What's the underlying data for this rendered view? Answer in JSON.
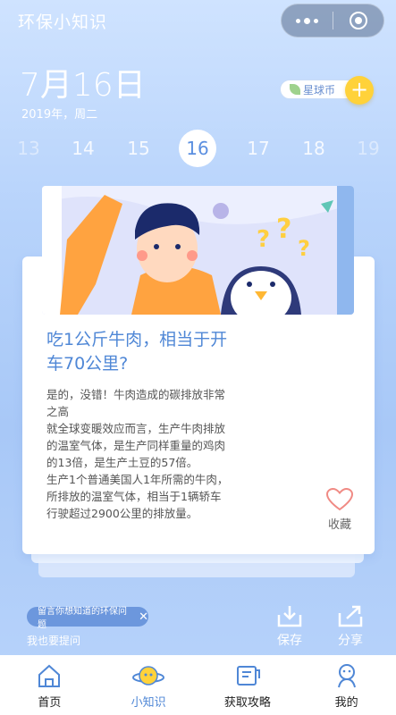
{
  "header": {
    "app_title": "环保小知识"
  },
  "date_header": {
    "big_date": "7月16日",
    "sub_date": "2019年，周二",
    "coin_label": "星球币",
    "plus": "+"
  },
  "date_strip": {
    "days": [
      "13",
      "14",
      "15",
      "16",
      "17",
      "18",
      "19"
    ],
    "selected": "16"
  },
  "card": {
    "title": "吃1公斤牛肉，相当于开车70公里?",
    "body": [
      "是的，没错！牛肉造成的碳排放非常之高",
      "就全球变暖效应而言，生产牛肉排放的温室气体，是生产同样重量的鸡肉的13倍，是生产土豆的57倍。",
      "生产1个普通美国人1年所需的牛肉，所排放的温室气体，相当于1辆轿车行驶超过2900公里的排放量。"
    ],
    "favorite_label": "收藏"
  },
  "bottom_actions": {
    "ask_pill_text": "留言你想知道的环保问题",
    "ask_label": "我也要提问",
    "save_label": "保存",
    "share_label": "分享"
  },
  "tabbar": {
    "tabs": [
      {
        "label": "首页",
        "icon": "home-icon"
      },
      {
        "label": "小知识",
        "icon": "planet-icon"
      },
      {
        "label": "获取攻略",
        "icon": "guide-icon"
      },
      {
        "label": "我的",
        "icon": "profile-icon"
      }
    ],
    "active": "小知识"
  },
  "colors": {
    "accent": "#4f87d6",
    "coin_button": "#ffd23a",
    "background_top": "#cfe3ff",
    "background_bottom": "#a8c8f7"
  }
}
